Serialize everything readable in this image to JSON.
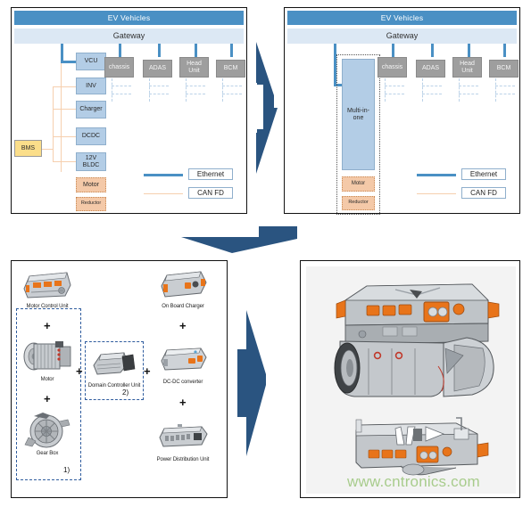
{
  "diagram_left": {
    "title": "EV Vehicles",
    "gateway": "Gateway",
    "blue_boxes": [
      {
        "label": "VCU"
      },
      {
        "label": "INV"
      },
      {
        "label": "Charger"
      },
      {
        "label": "DCDC"
      },
      {
        "label": "12V BLDC"
      }
    ],
    "orange_boxes": [
      {
        "label": "Motor"
      },
      {
        "label": "Reductor"
      }
    ],
    "yellow_box": {
      "label": "BMS"
    },
    "gray_boxes": [
      {
        "label": "chassis"
      },
      {
        "label": "ADAS"
      },
      {
        "label": "Head Unit"
      },
      {
        "label": "BCM"
      }
    ],
    "legend": [
      {
        "type": "ethernet",
        "label": "Ethernet",
        "color": "#4A90C4"
      },
      {
        "type": "canfd",
        "label": "CAN FD",
        "color": "#F6CFAE"
      }
    ]
  },
  "diagram_right": {
    "title": "EV Vehicles",
    "gateway": "Gateway",
    "multi_in_one": {
      "label": "Multi-in-one"
    },
    "orange_boxes": [
      {
        "label": "Motor"
      },
      {
        "label": "Reductor"
      }
    ],
    "gray_boxes": [
      {
        "label": "chassis"
      },
      {
        "label": "ADAS"
      },
      {
        "label": "Head Unit"
      },
      {
        "label": "BCM"
      }
    ],
    "legend": [
      {
        "type": "ethernet",
        "label": "Ethernet",
        "color": "#4A90C4"
      },
      {
        "type": "canfd",
        "label": "CAN FD",
        "color": "#F6CFAE"
      }
    ]
  },
  "components_panel": {
    "items": [
      {
        "label": "Motor Control Unit",
        "icon": "motor-control-unit-photo"
      },
      {
        "label": "Motor",
        "icon": "motor-photo"
      },
      {
        "label": "Gear Box",
        "icon": "gear-box-photo"
      },
      {
        "label": "On Board Charger",
        "icon": "on-board-charger-photo"
      },
      {
        "label": "Domain Controller Unit",
        "icon": "domain-controller-unit-photo"
      },
      {
        "label": "DC-DC converter",
        "icon": "dc-dc-converter-photo"
      },
      {
        "label": "Power Distribution Unit",
        "icon": "power-distribution-unit-photo"
      }
    ],
    "plus_symbol": "+",
    "annotations": [
      {
        "label": "1)"
      },
      {
        "label": "2)"
      }
    ]
  },
  "result_panel": {
    "watermark": "www.cntronics.com",
    "images": [
      {
        "icon": "integrated-edrive-assembly-perspective"
      },
      {
        "icon": "integrated-edrive-assembly-side"
      }
    ]
  },
  "arrows": [
    {
      "name": "arrow-right-top",
      "direction": "right",
      "color": "#2A5480"
    },
    {
      "name": "arrow-down-middle",
      "direction": "down",
      "color": "#2A5480"
    },
    {
      "name": "arrow-right-bottom",
      "direction": "right",
      "color": "#2A5480"
    }
  ],
  "colors": {
    "ethernet": "#4A90C4",
    "canfd": "#F6CFAE",
    "header": "#4A90C4",
    "gateway": "#DCE8F4",
    "ecu_gray": "#9E9E9E",
    "ecu_blue": "#B3CDE6",
    "ecu_orange": "#F4C9A8",
    "bms_yellow": "#FBDE8A",
    "arrow": "#2A5480",
    "watermark": "#8FBF6A"
  }
}
